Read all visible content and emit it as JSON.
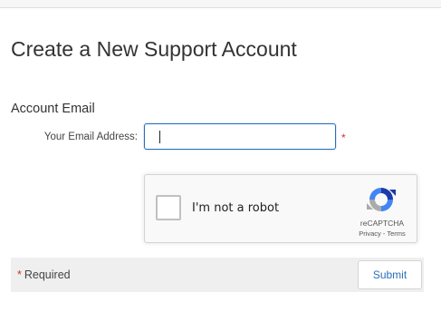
{
  "page": {
    "title": "Create a New Support Account"
  },
  "form": {
    "section_label": "Account Email",
    "email_label": "Your Email Address:",
    "email_value": "",
    "required_marker": "*"
  },
  "captcha": {
    "checkbox_label": "I'm not a robot",
    "brand": "reCAPTCHA",
    "links": "Privacy - Terms",
    "logo_icon": "recaptcha-logo-icon"
  },
  "footer": {
    "required_star": "*",
    "required_text": "Required",
    "submit_label": "Submit"
  },
  "colors": {
    "accent": "#2a6fbd",
    "required": "#d0312d",
    "footer_bg": "#efefef"
  }
}
